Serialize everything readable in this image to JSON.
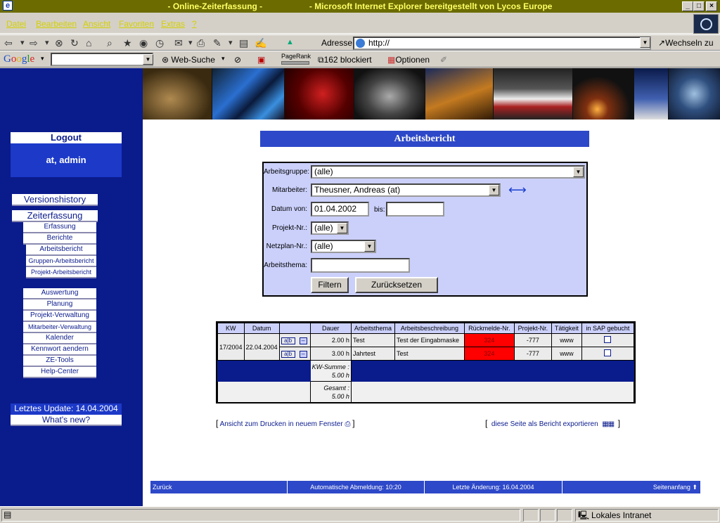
{
  "window": {
    "title": "- Online-Zeiterfassung -                    - Microsoft Internet Explorer bereitgestellt von Lycos Europe",
    "minimize": "_",
    "maximize": "□",
    "close": "×"
  },
  "menu": [
    "Datei",
    "Bearbeiten",
    "Ansicht",
    "Favoriten",
    "Extras",
    "?"
  ],
  "address": {
    "label": "Adresse",
    "url": "http://",
    "go_label": "Wechseln zu"
  },
  "google_toolbar": {
    "logo": "Google",
    "web_search": "Web-Suche",
    "pagerank": "PageRank",
    "blocked": "162 blockiert",
    "options": "Optionen"
  },
  "sidebar": {
    "logout": "Logout",
    "user": "at, admin",
    "versionshistory": "Versionshistory",
    "zeiterfassung": "Zeiterfassung",
    "sub1": [
      "Erfassung",
      "Berichte",
      "Arbeitsbericht",
      "Gruppen-Arbeitsbericht",
      "Projekt-Arbeitsbericht"
    ],
    "sub2": [
      "Auswertung",
      "Planung",
      "Projekt-Verwaltung",
      "Mitarbeiter-Verwaltung",
      "Kalender",
      "Kennwort aendern",
      "ZE-Tools",
      "Help-Center"
    ],
    "last_update": "Letztes Update: 14.04.2004",
    "whats_new": "What's new?"
  },
  "report": {
    "title": "Arbeitsbericht",
    "filter": {
      "arbeitsgruppe_label": "Arbeitsgruppe:",
      "arbeitsgruppe_value": "(alle)",
      "mitarbeiter_label": "Mitarbeiter:",
      "mitarbeiter_value": "Theusner, Andreas (at)",
      "datum_von_label": "Datum von:",
      "datum_von_value": "01.04.2002",
      "bis_label": "bis:",
      "bis_value": "",
      "projekt_label": "Projekt-Nr.:",
      "projekt_value": "(alle)",
      "netzplan_label": "Netzplan-Nr.:",
      "netzplan_value": "(alle)",
      "thema_label": "Arbeitsthema:",
      "thema_value": "",
      "filter_button": "Filtern",
      "reset_button": "Zurücksetzen"
    },
    "table": {
      "headers": [
        "KW",
        "Datum",
        "",
        "Dauer",
        "Arbeitsthema",
        "Arbeitsbeschreibung",
        "Rückmelde-Nr.",
        "Projekt-Nr.",
        "Tätigkeit",
        "in SAP gebucht"
      ],
      "kw": "17/2004",
      "datum": "22.04.2004",
      "rows": [
        {
          "dauer": "2.00 h",
          "thema": "Test",
          "beschreibung": "Test der Eingabmaske",
          "rueckmelde": "324",
          "projekt": "-777",
          "taetigkeit": "www"
        },
        {
          "dauer": "3.00 h",
          "thema": "Jahrtest",
          "beschreibung": "Test",
          "rueckmelde": "324",
          "projekt": "-777",
          "taetigkeit": "www"
        }
      ],
      "edit_icon_text": "a|b",
      "kw_summe_label": "KW-Summe :",
      "kw_summe_value": "5.00 h",
      "gesamt_label": "Gesamt :",
      "gesamt_value": "5.00 h"
    },
    "print_link": "Ansicht zum Drucken in neuem Fenster",
    "export_link": "diese Seite als Bericht exportieren"
  },
  "footer": {
    "back": "Zurück",
    "auto_logout": "Automatische Abmeldung: 10:20",
    "last_change": "Letzte Änderung: 16.04.2004",
    "top": "Seitenanfang"
  },
  "status": {
    "zone": "Lokales Intranet"
  }
}
